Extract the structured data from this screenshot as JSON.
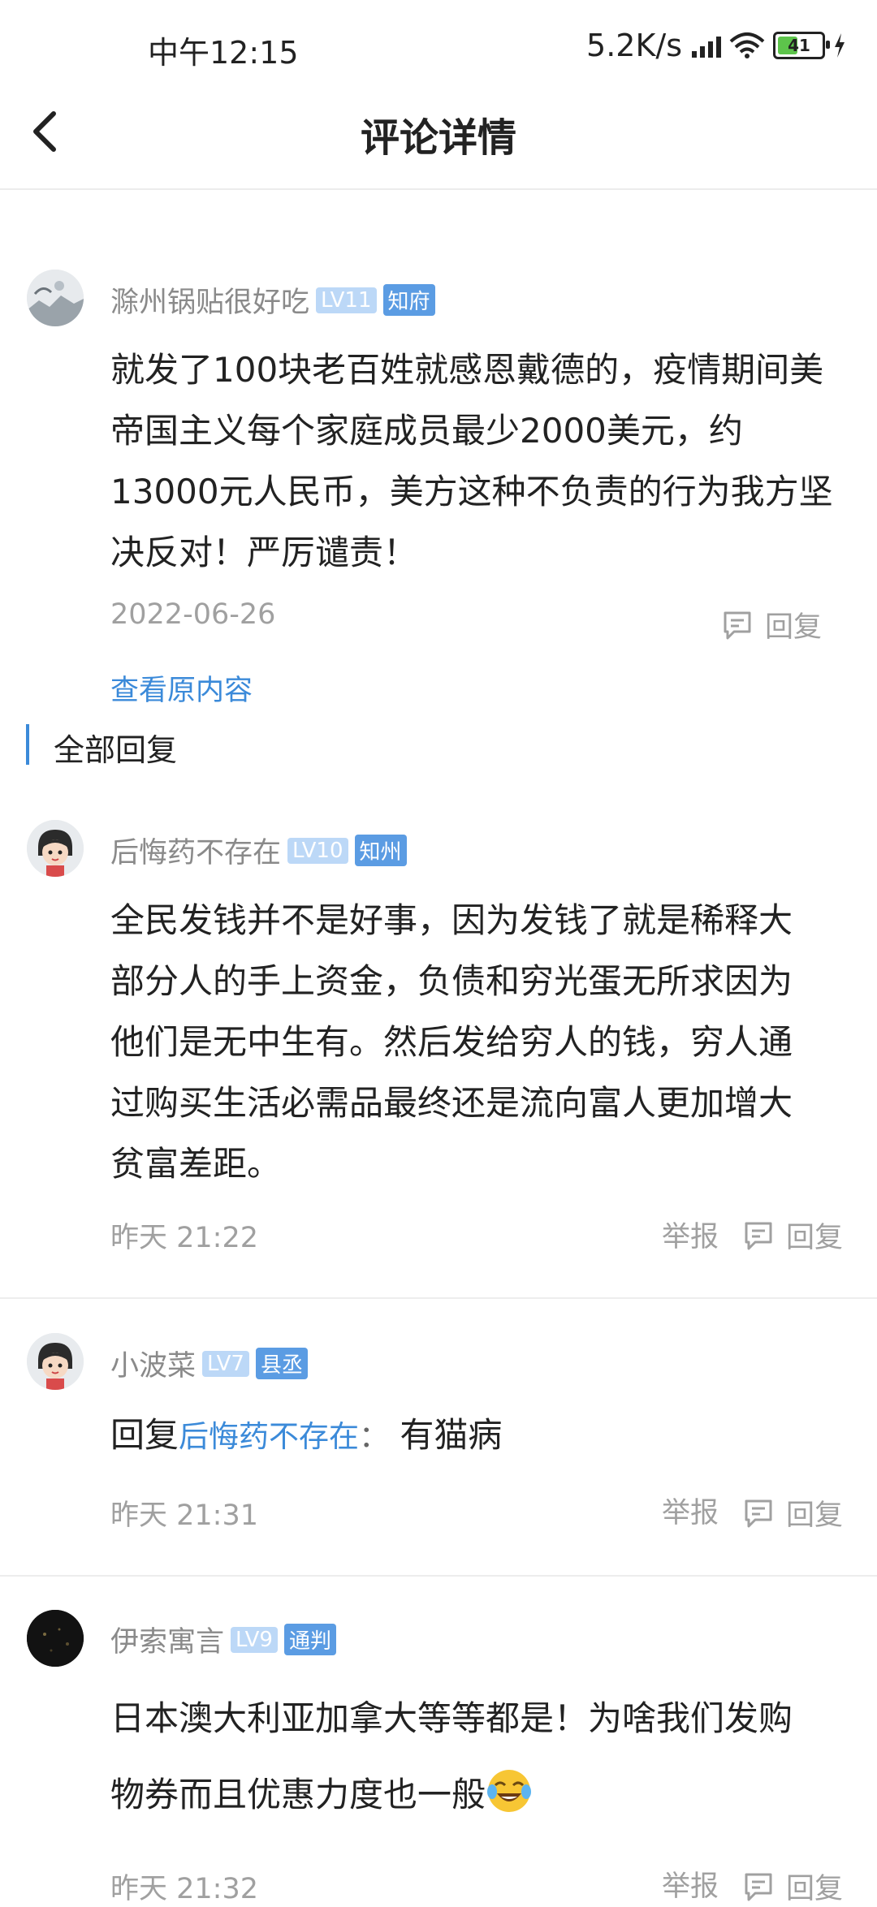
{
  "status_bar": {
    "time": "中午12:15",
    "speed": "5.2K/s",
    "battery": "41"
  },
  "header": {
    "title": "评论详情"
  },
  "original": {
    "author": "滁州锅贴很好吃",
    "level": "LV11",
    "rank": "知府",
    "text": "就发了100块老百姓就感恩戴德的，疫情期间美帝国主义每个家庭成员最少2000美元，约13000元人民币，美方这种不负责的行为我方坚决反对！严厉谴责！",
    "date": "2022-06-26",
    "reply_label": "回复",
    "view_original": "查看原内容"
  },
  "section": {
    "title": "全部回复"
  },
  "replies": [
    {
      "author": "后悔药不存在",
      "level": "LV10",
      "rank": "知州",
      "text": "全民发钱并不是好事，因为发钱了就是稀释大部分人的手上资金，负债和穷光蛋无所求因为他们是无中生有。然后发给穷人的钱，穷人通过购买生活必需品最终还是流向富人更加增大贫富差距。",
      "time": "昨天 21:22",
      "report_label": "举报",
      "reply_label": "回复"
    },
    {
      "author": "小波菜",
      "level": "LV7",
      "rank": "县丞",
      "reply_prefix": "回复",
      "reply_to": "后悔药不存在",
      "reply_colon": "：",
      "text": "有猫病",
      "time": "昨天 21:31",
      "report_label": "举报",
      "reply_label": "回复"
    },
    {
      "author": "伊索寓言",
      "level": "LV9",
      "rank": "通判",
      "text": "日本澳大利亚加拿大等等都是！为啥我们发购物券而且优惠力度也一般",
      "time": "昨天 21:32",
      "report_label": "举报",
      "reply_label": "回复"
    }
  ]
}
